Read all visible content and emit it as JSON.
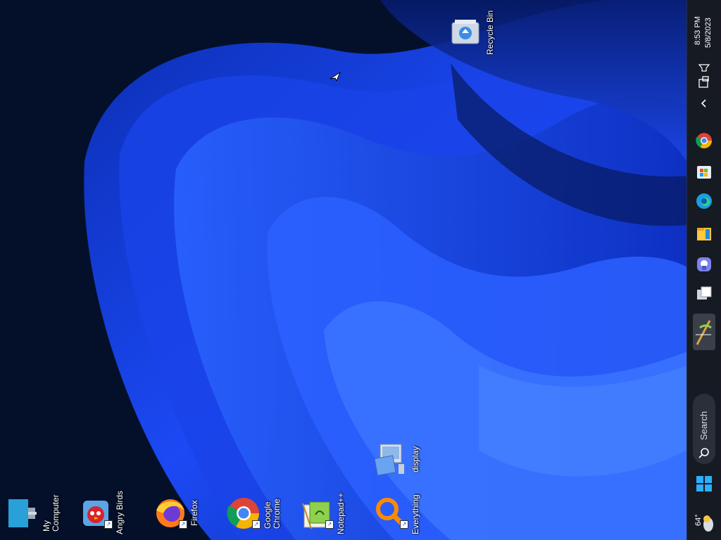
{
  "desktop": {
    "icons": {
      "recycle_bin": "Recycle Bin",
      "my_computer": "My\nComputer",
      "angry_birds": "Angry Birds",
      "firefox": "Firefox",
      "chrome": "Google\nChrome",
      "notepadpp": "Notepad++",
      "everything": "Everything",
      "display": "display"
    }
  },
  "taskbar": {
    "clock": {
      "time": "8:53 PM",
      "date": "5/8/2023"
    },
    "search_label": "Search",
    "weather_temp": "64°",
    "pinned_icons": [
      "chrome-icon",
      "store-icon",
      "edge-icon",
      "file-explorer-icon",
      "teams-icon",
      "task-view-icon",
      "notepadpp-icon"
    ]
  },
  "colors": {
    "wallpaper_dark": "#020a1e",
    "wallpaper_blue": "#1a3fd6",
    "taskbar_bg": "#161a22",
    "start_blue": "#2ab0ff"
  }
}
